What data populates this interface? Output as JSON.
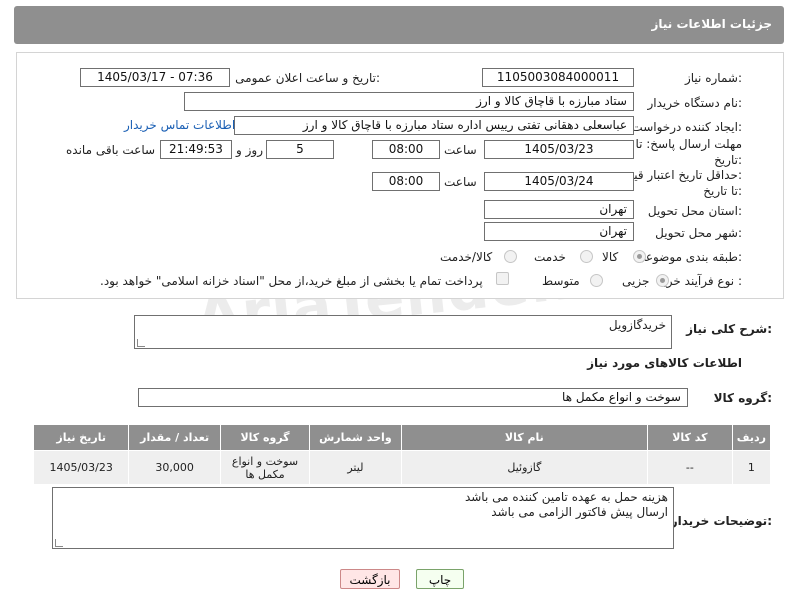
{
  "header": {
    "title": "جزئیات اطلاعات نیاز"
  },
  "form": {
    "need_number": {
      "label": "شماره نیاز:",
      "value": "1105003084000011"
    },
    "announce_datetime": {
      "label": "تاریخ و ساعت اعلان عمومی:",
      "value": "1405/03/17 - 07:36"
    },
    "buyer_org": {
      "label": "نام دستگاه خریدار:",
      "value": "ستاد مبارزه با قاچاق کالا و ارز"
    },
    "creator": {
      "label": "ایجاد کننده درخواست:",
      "value": "عباسعلی  دهقانی تفتی رییس اداره ستاد مبارزه با قاچاق کالا و ارز",
      "contact_link": "اطلاعات تماس خریدار"
    },
    "response_deadline": {
      "label_line1": "مهلت ارسال پاسخ: تا",
      "label_line2": "تاریخ:",
      "date": "1405/03/23",
      "time_label": "ساعت",
      "time": "08:00",
      "days": "5",
      "days_label": "روز و",
      "remaining": "21:49:53",
      "remaining_label": "ساعت باقی مانده"
    },
    "price_validity": {
      "label_line1": "حداقل تاریخ اعتبار قیمت:",
      "label_line2": "تا تاریخ:",
      "date": "1405/03/24",
      "time_label": "ساعت",
      "time": "08:00"
    },
    "delivery_province": {
      "label": "استان محل تحویل:",
      "value": "تهران"
    },
    "delivery_city": {
      "label": "شهر محل تحویل:",
      "value": "تهران"
    },
    "category": {
      "label": "طبقه بندی موضوعی:",
      "options": [
        "کالا",
        "خدمت",
        "کالا/خدمت"
      ],
      "selected": "کالا"
    },
    "purchase_type": {
      "label": "نوع فرآیند خرید :",
      "options": [
        "جزیی",
        "متوسط"
      ],
      "selected": "جزیی",
      "treasury_note": "پرداخت تمام یا بخشی از مبلغ خرید،از محل \"اسناد خزانه اسلامی\" خواهد بود."
    }
  },
  "description": {
    "label": "شرح کلی نیاز:",
    "value": "خریدگازویل"
  },
  "goods_section": {
    "title": "اطلاعات کالاهای مورد نیاز",
    "group_label": "گروه کالا:",
    "group_value": "سوخت و انواع مکمل ها"
  },
  "table": {
    "headers": [
      "ردیف",
      "کد کالا",
      "نام کالا",
      "واحد شمارش",
      "گروه کالا",
      "تعداد / مقدار",
      "تاریخ نیاز"
    ],
    "rows": [
      [
        "1",
        "--",
        "گازوئیل",
        "لیتر",
        "سوخت و انواع مکمل ها",
        "30,000",
        "1405/03/23"
      ]
    ]
  },
  "buyer_notes": {
    "label": "توضیحات خریدار:",
    "line1": "هزینه حمل به عهده تامین کننده می باشد",
    "line2": "ارسال پیش فاکتور الزامی می باشد"
  },
  "buttons": {
    "print": "چاپ",
    "back": "بازگشت"
  },
  "watermark": "AriaTender.net"
}
